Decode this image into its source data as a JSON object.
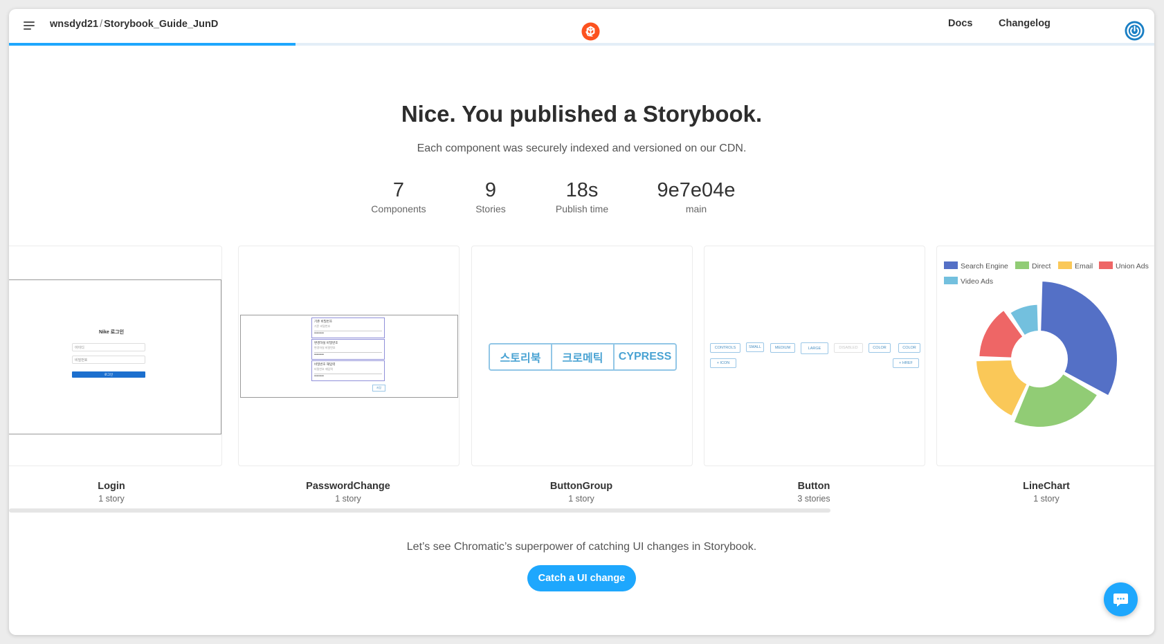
{
  "header": {
    "owner": "wnsdyd21",
    "separator": "/",
    "project": "Storybook_Guide_JunD",
    "nav": {
      "docs": "Docs",
      "changelog": "Changelog"
    },
    "progress_percent": 25,
    "icons": {
      "menu": "menu-icon",
      "logo": "chromatic-logo",
      "account": "power-icon"
    }
  },
  "hero": {
    "title": "Nice. You published a Storybook.",
    "subtitle": "Each component was securely indexed and versioned on our CDN."
  },
  "stats": [
    {
      "value": "7",
      "label": "Components"
    },
    {
      "value": "9",
      "label": "Stories"
    },
    {
      "value": "18s",
      "label": "Publish time"
    },
    {
      "value": "9e7e04e",
      "label": "main"
    }
  ],
  "components": [
    {
      "name": "Login",
      "count": "1 story",
      "preview": {
        "title": "Nike 로그인",
        "id_placeholder": "아이디",
        "password_placeholder": "비밀번호",
        "submit": "로그인"
      }
    },
    {
      "name": "PasswordChange",
      "count": "1 story",
      "preview": {
        "fields": [
          "기존 비밀번호",
          "변경하실 비밀번호",
          "비밀번호 재입력"
        ],
        "hints": [
          "기존 비밀번호",
          "변경하실 비밀번호",
          "비밀번호 재입력"
        ],
        "submit": "저장"
      }
    },
    {
      "name": "ButtonGroup",
      "count": "1 story",
      "preview": {
        "buttons": [
          "스토리북",
          "크로메틱",
          "CYPRESS"
        ]
      }
    },
    {
      "name": "Button",
      "count": "3 stories",
      "preview": {
        "row1": [
          "CONTROLS",
          "SMALL",
          "MEDIUM",
          "LARGE",
          "DISABLED",
          "COLOR",
          "COLOR"
        ],
        "row2": [
          "+ ICON",
          "+ HREF"
        ]
      }
    },
    {
      "name": "LineChart",
      "count": "1 story",
      "preview": {
        "legend": [
          "Search Engine",
          "Direct",
          "Email",
          "Union Ads",
          "Video Ads"
        ]
      }
    }
  ],
  "chart_data": {
    "type": "pie",
    "categories": [
      "Search Engine",
      "Direct",
      "Email",
      "Union Ads",
      "Video Ads"
    ],
    "values": [
      1048,
      735,
      580,
      484,
      300
    ],
    "colors": [
      "#5470c6",
      "#91cc75",
      "#fac858",
      "#ee6666",
      "#73c0de"
    ],
    "legend_position": "top"
  },
  "cta": {
    "text": "Let’s see Chromatic’s superpower of catching UI changes in Storybook.",
    "button": "Catch a UI change"
  },
  "colors": {
    "accent": "#1ea7fd",
    "logo": "#fc521f"
  },
  "chat": {
    "icon": "chat-bubble-icon"
  }
}
